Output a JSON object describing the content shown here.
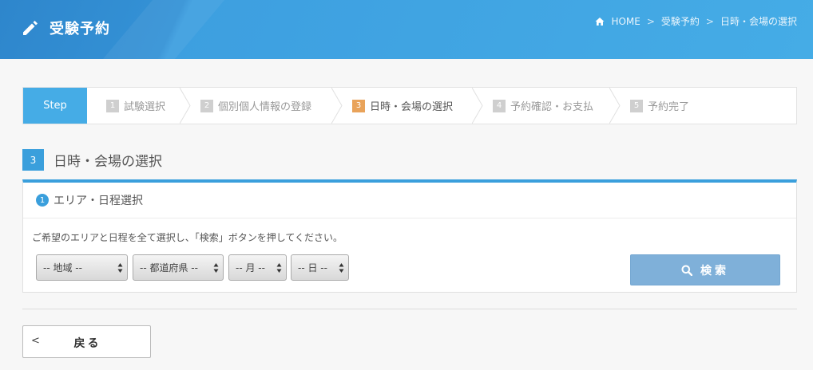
{
  "header": {
    "title": "受験予約",
    "breadcrumb": [
      "HOME",
      "受験予約",
      "日時・会場の選択"
    ],
    "separator": ">",
    "accent": "#45ace6"
  },
  "steps": {
    "tag": "Step",
    "items": [
      {
        "num": "1",
        "label": "試験選択",
        "active": false
      },
      {
        "num": "2",
        "label": "個別個人情報の登録",
        "active": false
      },
      {
        "num": "3",
        "label": "日時・会場の選択",
        "active": true
      },
      {
        "num": "4",
        "label": "予約確認・お支払",
        "active": false
      },
      {
        "num": "5",
        "label": "予約完了",
        "active": false
      }
    ]
  },
  "section": {
    "num": "3",
    "title": "日時・会場の選択"
  },
  "panel": {
    "num": "1",
    "title": "エリア・日程選択",
    "instruction": "ご希望のエリアと日程を全て選択し、「検索」ボタンを押してください。",
    "selects": {
      "region": "-- 地域 --",
      "prefecture": "-- 都道府県 --",
      "month": "-- 月 --",
      "day": "-- 日 --"
    },
    "search_label": "検索"
  },
  "footer": {
    "back_label": "戻る",
    "back_icon": "<"
  }
}
